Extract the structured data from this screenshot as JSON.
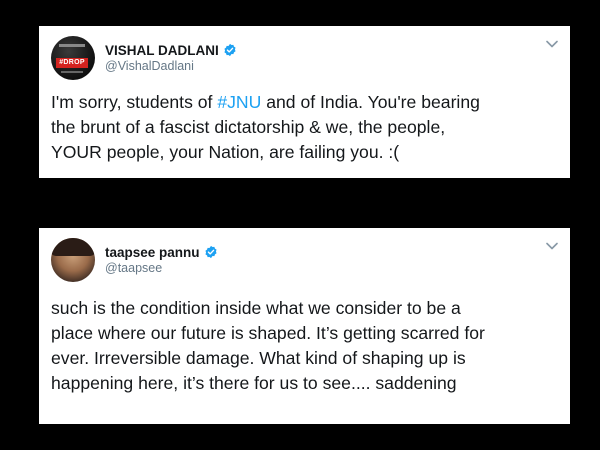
{
  "colors": {
    "background": "#000000",
    "card": "#ffffff",
    "text": "#14171a",
    "handle": "#657786",
    "link": "#1da1f2",
    "verified": "#1da1f2"
  },
  "tweets": [
    {
      "avatar_icon": "avatar-drop-logo",
      "avatar_badge": "#DROP",
      "display_name": "VISHAL DADLANI",
      "verified_icon": "verified-badge-icon",
      "handle": "@VishalDadlani",
      "menu_icon": "chevron-down-icon",
      "text_before": "I'm sorry, students of ",
      "hashtag": "#JNU",
      "text_after": " and of India. You're bearing\nthe brunt of a fascist dictatorship & we, the people,\nYOUR people, your Nation, are failing you. :("
    },
    {
      "avatar_icon": "avatar-photo",
      "display_name": "taapsee pannu",
      "verified_icon": "verified-badge-icon",
      "handle": "@taapsee",
      "menu_icon": "chevron-down-icon",
      "text": "such is the condition inside what we consider to be a\nplace where our future is shaped. It’s getting scarred for\never. Irreversible damage. What kind of shaping up is\nhappening here, it’s there for us to see.... saddening"
    }
  ]
}
